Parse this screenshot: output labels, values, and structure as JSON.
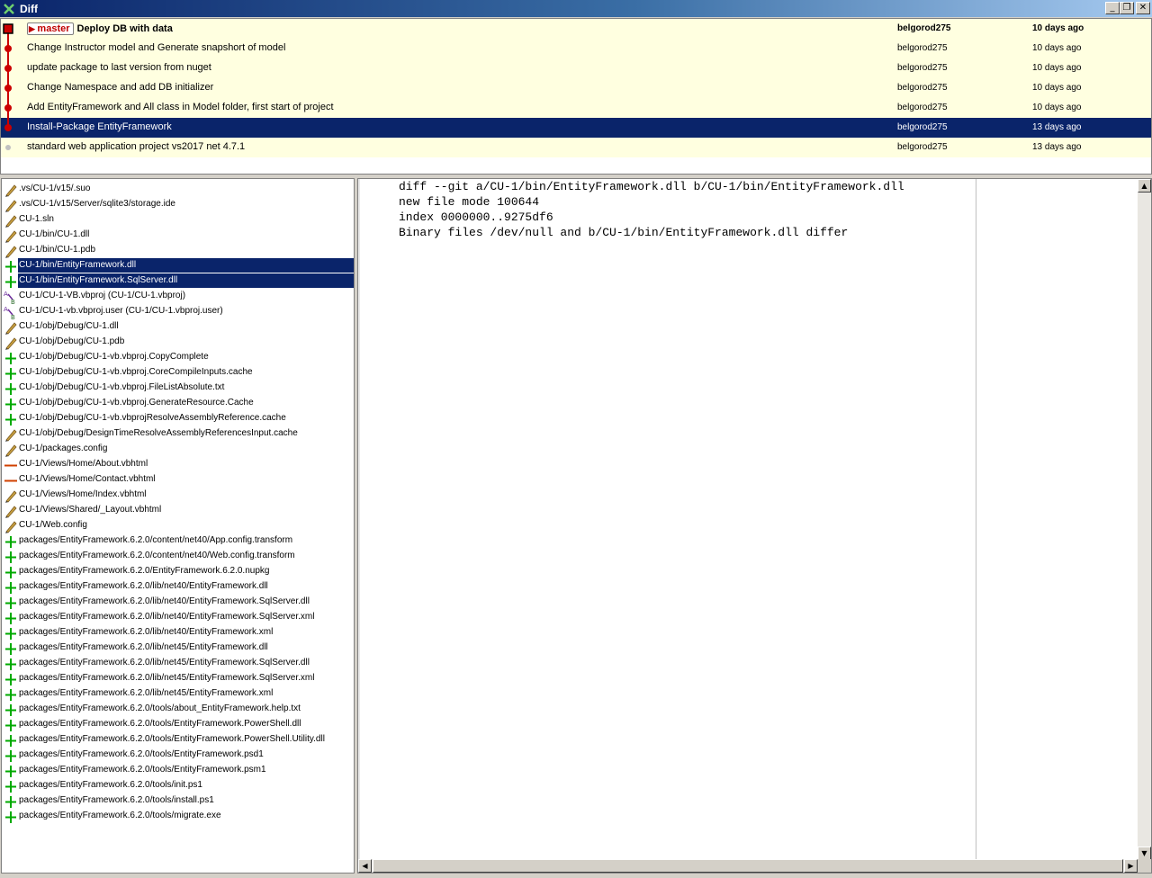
{
  "window": {
    "title": "Diff"
  },
  "commits": [
    {
      "message": "Deploy DB with data",
      "author": "belgorod275",
      "date": "10 days ago",
      "branch": "master",
      "head": true,
      "selected": false
    },
    {
      "message": "Change Instructor model and Generate snapshort of model",
      "author": "belgorod275",
      "date": "10 days ago",
      "selected": false
    },
    {
      "message": "update package to last version from nuget",
      "author": "belgorod275",
      "date": "10 days ago",
      "selected": false
    },
    {
      "message": "Change Namespace and add DB initializer",
      "author": "belgorod275",
      "date": "10 days ago",
      "selected": false
    },
    {
      "message": "Add EntityFramework and All class in Model folder, first start of project",
      "author": "belgorod275",
      "date": "10 days ago",
      "selected": false
    },
    {
      "message": "Install-Package EntityFramework",
      "author": "belgorod275",
      "date": "13 days ago",
      "selected": true
    },
    {
      "message": "standard web application project vs2017 net 4.7.1",
      "author": "belgorod275",
      "date": "13 days ago",
      "selected": false
    }
  ],
  "files": [
    {
      "path": ".vs/CU-1/v15/.suo",
      "status": "modified"
    },
    {
      "path": ".vs/CU-1/v15/Server/sqlite3/storage.ide",
      "status": "modified"
    },
    {
      "path": "CU-1.sln",
      "status": "modified"
    },
    {
      "path": "CU-1/bin/CU-1.dll",
      "status": "modified"
    },
    {
      "path": "CU-1/bin/CU-1.pdb",
      "status": "modified"
    },
    {
      "path": "CU-1/bin/EntityFramework.dll",
      "status": "added",
      "selected": true
    },
    {
      "path": "CU-1/bin/EntityFramework.SqlServer.dll",
      "status": "added",
      "selected": true
    },
    {
      "path": "CU-1/CU-1-VB.vbproj (CU-1/CU-1.vbproj)",
      "status": "renamed"
    },
    {
      "path": "CU-1/CU-1-vb.vbproj.user (CU-1/CU-1.vbproj.user)",
      "status": "renamed"
    },
    {
      "path": "CU-1/obj/Debug/CU-1.dll",
      "status": "modified"
    },
    {
      "path": "CU-1/obj/Debug/CU-1.pdb",
      "status": "modified"
    },
    {
      "path": "CU-1/obj/Debug/CU-1-vb.vbproj.CopyComplete",
      "status": "added"
    },
    {
      "path": "CU-1/obj/Debug/CU-1-vb.vbproj.CoreCompileInputs.cache",
      "status": "added"
    },
    {
      "path": "CU-1/obj/Debug/CU-1-vb.vbproj.FileListAbsolute.txt",
      "status": "added"
    },
    {
      "path": "CU-1/obj/Debug/CU-1-vb.vbproj.GenerateResource.Cache",
      "status": "added"
    },
    {
      "path": "CU-1/obj/Debug/CU-1-vb.vbprojResolveAssemblyReference.cache",
      "status": "added"
    },
    {
      "path": "CU-1/obj/Debug/DesignTimeResolveAssemblyReferencesInput.cache",
      "status": "modified"
    },
    {
      "path": "CU-1/packages.config",
      "status": "modified"
    },
    {
      "path": "CU-1/Views/Home/About.vbhtml",
      "status": "deleted"
    },
    {
      "path": "CU-1/Views/Home/Contact.vbhtml",
      "status": "deleted"
    },
    {
      "path": "CU-1/Views/Home/Index.vbhtml",
      "status": "modified"
    },
    {
      "path": "CU-1/Views/Shared/_Layout.vbhtml",
      "status": "modified"
    },
    {
      "path": "CU-1/Web.config",
      "status": "modified"
    },
    {
      "path": "packages/EntityFramework.6.2.0/content/net40/App.config.transform",
      "status": "added"
    },
    {
      "path": "packages/EntityFramework.6.2.0/content/net40/Web.config.transform",
      "status": "added"
    },
    {
      "path": "packages/EntityFramework.6.2.0/EntityFramework.6.2.0.nupkg",
      "status": "added"
    },
    {
      "path": "packages/EntityFramework.6.2.0/lib/net40/EntityFramework.dll",
      "status": "added"
    },
    {
      "path": "packages/EntityFramework.6.2.0/lib/net40/EntityFramework.SqlServer.dll",
      "status": "added"
    },
    {
      "path": "packages/EntityFramework.6.2.0/lib/net40/EntityFramework.SqlServer.xml",
      "status": "added"
    },
    {
      "path": "packages/EntityFramework.6.2.0/lib/net40/EntityFramework.xml",
      "status": "added"
    },
    {
      "path": "packages/EntityFramework.6.2.0/lib/net45/EntityFramework.dll",
      "status": "added"
    },
    {
      "path": "packages/EntityFramework.6.2.0/lib/net45/EntityFramework.SqlServer.dll",
      "status": "added"
    },
    {
      "path": "packages/EntityFramework.6.2.0/lib/net45/EntityFramework.SqlServer.xml",
      "status": "added"
    },
    {
      "path": "packages/EntityFramework.6.2.0/lib/net45/EntityFramework.xml",
      "status": "added"
    },
    {
      "path": "packages/EntityFramework.6.2.0/tools/about_EntityFramework.help.txt",
      "status": "added"
    },
    {
      "path": "packages/EntityFramework.6.2.0/tools/EntityFramework.PowerShell.dll",
      "status": "added"
    },
    {
      "path": "packages/EntityFramework.6.2.0/tools/EntityFramework.PowerShell.Utility.dll",
      "status": "added"
    },
    {
      "path": "packages/EntityFramework.6.2.0/tools/EntityFramework.psd1",
      "status": "added"
    },
    {
      "path": "packages/EntityFramework.6.2.0/tools/EntityFramework.psm1",
      "status": "added"
    },
    {
      "path": "packages/EntityFramework.6.2.0/tools/init.ps1",
      "status": "added"
    },
    {
      "path": "packages/EntityFramework.6.2.0/tools/install.ps1",
      "status": "added"
    },
    {
      "path": "packages/EntityFramework.6.2.0/tools/migrate.exe",
      "status": "added"
    }
  ],
  "diff_lines": [
    "diff --git a/CU-1/bin/EntityFramework.dll b/CU-1/bin/EntityFramework.dll",
    "new file mode 100644",
    "index 0000000..9275df6",
    "Binary files /dev/null and b/CU-1/bin/EntityFramework.dll differ"
  ],
  "colors": {
    "titlebar": "#0a246a",
    "selection": "#0a246a",
    "commit_bg": "#ffffe0",
    "graph_line": "#cc0000",
    "added": "#00aa00",
    "deleted": "#d04000",
    "modified": "#c8a040"
  },
  "window_buttons": {
    "minimize": "_",
    "restore": "❐",
    "close": "✕"
  },
  "scroll": {
    "up": "▲",
    "down": "▼",
    "left": "◀",
    "right": "▶"
  }
}
